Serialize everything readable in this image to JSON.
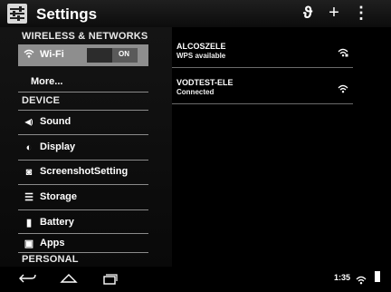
{
  "app": {
    "title": "Settings",
    "icon": "settings-sliders-icon"
  },
  "actions": [
    {
      "name": "sync-icon",
      "glyph": "ϑ"
    },
    {
      "name": "add-icon",
      "glyph": "+"
    },
    {
      "name": "overflow-menu-icon",
      "glyph": "⋮"
    }
  ],
  "sidebar": {
    "category_wireless": "WIRELESS & NETWORKS",
    "wifi": {
      "label": "Wi-Fi",
      "toggle": "ON",
      "icon": "wifi-icon"
    },
    "more": "More...",
    "category_device": "DEVICE",
    "items": [
      {
        "label": "Sound",
        "icon": "speaker-icon",
        "glyph": "◀)"
      },
      {
        "label": "Display",
        "icon": "display-brightness-icon",
        "glyph": "◐"
      },
      {
        "label": "ScreenshotSetting",
        "icon": "camera-icon",
        "glyph": "◙"
      },
      {
        "label": "Storage",
        "icon": "storage-icon",
        "glyph": "☰"
      },
      {
        "label": "Battery",
        "icon": "battery-icon",
        "glyph": "▮"
      },
      {
        "label": "Apps",
        "icon": "apps-icon",
        "glyph": "▣"
      }
    ],
    "category_personal": "PERSONAL"
  },
  "networks": [
    {
      "name": "ALCOSZELE",
      "status": "WPS available",
      "icon": "wifi-signal-locked-icon"
    },
    {
      "name": "VODTEST-ELE",
      "status": "Connected",
      "icon": "wifi-signal-icon"
    }
  ],
  "statusbar": {
    "time": "1:35"
  },
  "colors": {
    "background": "#000000",
    "selected": "#8e8e8e",
    "divider": "#8a8a8a"
  }
}
